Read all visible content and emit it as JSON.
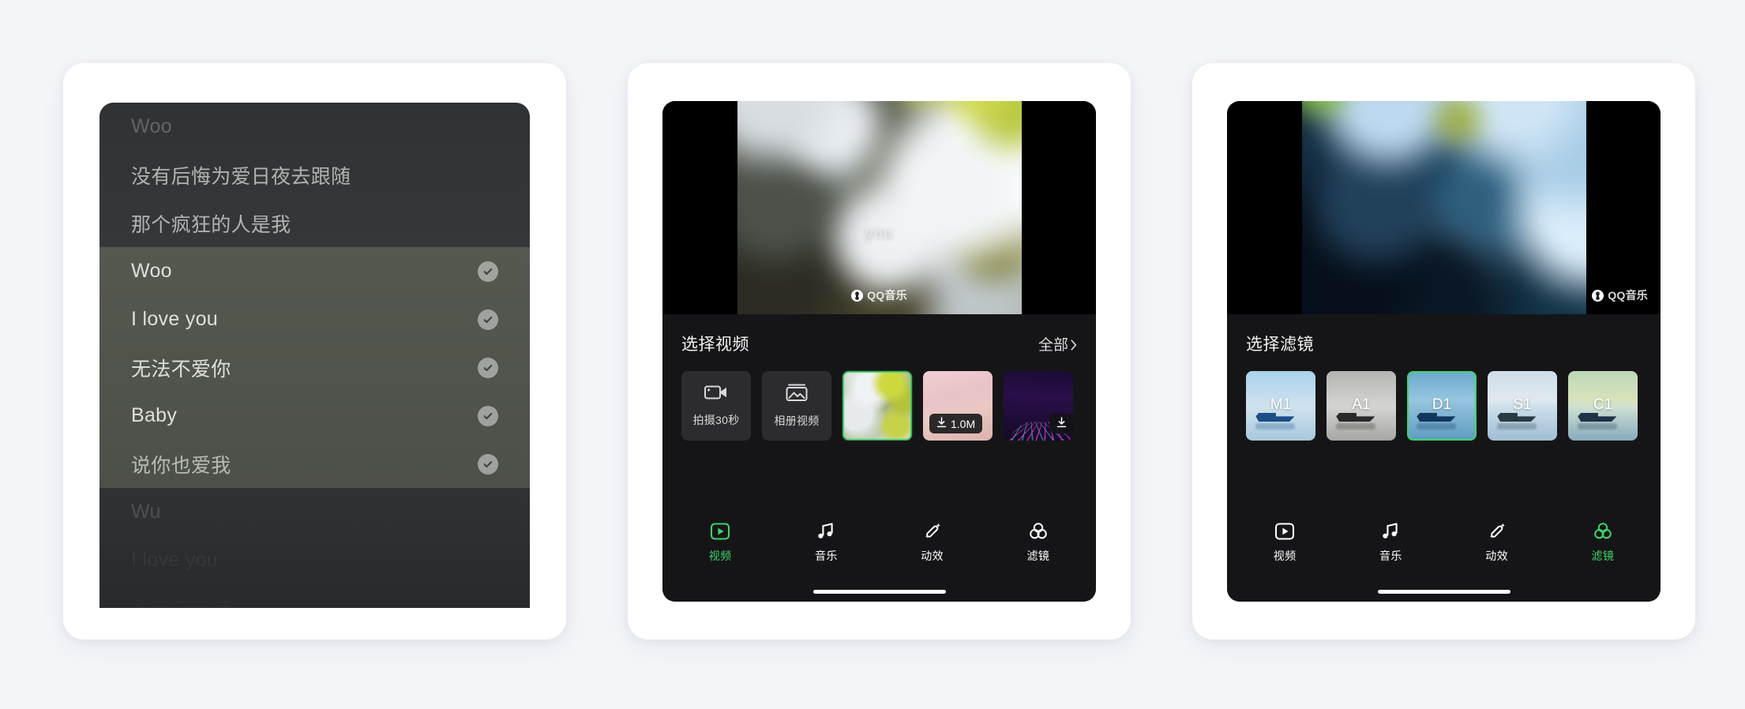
{
  "lyrics_panel": {
    "name": "lyric-select-sheet",
    "bands": [
      {
        "id": "top",
        "rows": [
          {
            "text": "Woo",
            "tone": "dim",
            "check": false
          },
          {
            "text": "没有后悔为爱日夜去跟随",
            "tone": "mid",
            "check": false
          },
          {
            "text": "那个疯狂的人是我",
            "tone": "mid",
            "check": false
          }
        ]
      },
      {
        "id": "middle",
        "rows": [
          {
            "text": "Woo",
            "tone": "bright",
            "check": true
          },
          {
            "text": "I love you",
            "tone": "bright",
            "check": true
          },
          {
            "text": "无法不爱你",
            "tone": "bright",
            "check": true
          },
          {
            "text": "Baby",
            "tone": "bright",
            "check": true
          },
          {
            "text": "说你也爱我",
            "tone": "mid",
            "check": true
          }
        ]
      },
      {
        "id": "bottom",
        "rows": [
          {
            "text": "Wu",
            "tone": "faint",
            "check": false
          },
          {
            "text": "I love you",
            "tone": "ghost",
            "check": false
          },
          {
            "text": "永远不愿意",
            "tone": "ghost",
            "check": false
          }
        ]
      }
    ]
  },
  "video_panel": {
    "preview": {
      "lyric_overlay": "you",
      "watermark": "QQ音乐",
      "watermark_logo_icon": "qq-music-logo-icon"
    },
    "header": {
      "title": "选择视频",
      "all_label": "全部",
      "chevron_icon": "chevron-right-icon"
    },
    "actions": [
      {
        "label": "拍摄30秒",
        "icon": "video-camera-icon"
      },
      {
        "label": "相册视频",
        "icon": "photo-library-icon"
      }
    ],
    "media": [
      {
        "name": "leaf-clip",
        "selected": true,
        "badge": null
      },
      {
        "name": "pink-sky-clip",
        "selected": false,
        "badge": "1.0M",
        "badge_icon": "download-icon"
      },
      {
        "name": "neon-grid-clip",
        "selected": false,
        "badge": "",
        "badge_icon": "download-icon"
      }
    ],
    "tabs": [
      {
        "label": "视频",
        "icon": "play-square-icon",
        "active": true
      },
      {
        "label": "音乐",
        "icon": "music-note-icon",
        "active": false
      },
      {
        "label": "动效",
        "icon": "magic-wand-icon",
        "active": false
      },
      {
        "label": "滤镜",
        "icon": "filter-circles-icon",
        "active": false
      }
    ]
  },
  "filter_panel": {
    "preview": {
      "watermark": "QQ音乐",
      "watermark_logo_icon": "qq-music-logo-icon"
    },
    "header": {
      "title": "选择滤镜"
    },
    "filters": [
      {
        "label": "M1",
        "selected": false
      },
      {
        "label": "A1",
        "selected": false
      },
      {
        "label": "D1",
        "selected": true
      },
      {
        "label": "S1",
        "selected": false
      },
      {
        "label": "C1",
        "selected": false
      }
    ],
    "tabs": [
      {
        "label": "视频",
        "icon": "play-square-icon",
        "active": false
      },
      {
        "label": "音乐",
        "icon": "music-note-icon",
        "active": false
      },
      {
        "label": "动效",
        "icon": "magic-wand-icon",
        "active": false
      },
      {
        "label": "滤镜",
        "icon": "filter-circles-icon",
        "active": true
      }
    ]
  },
  "colors": {
    "accent_green": "#3fd36a",
    "page_bg": "#f4f5f9",
    "card_bg": "#ffffff",
    "phone_bg": "#0d0d0f",
    "picker_bg": "#151517"
  }
}
